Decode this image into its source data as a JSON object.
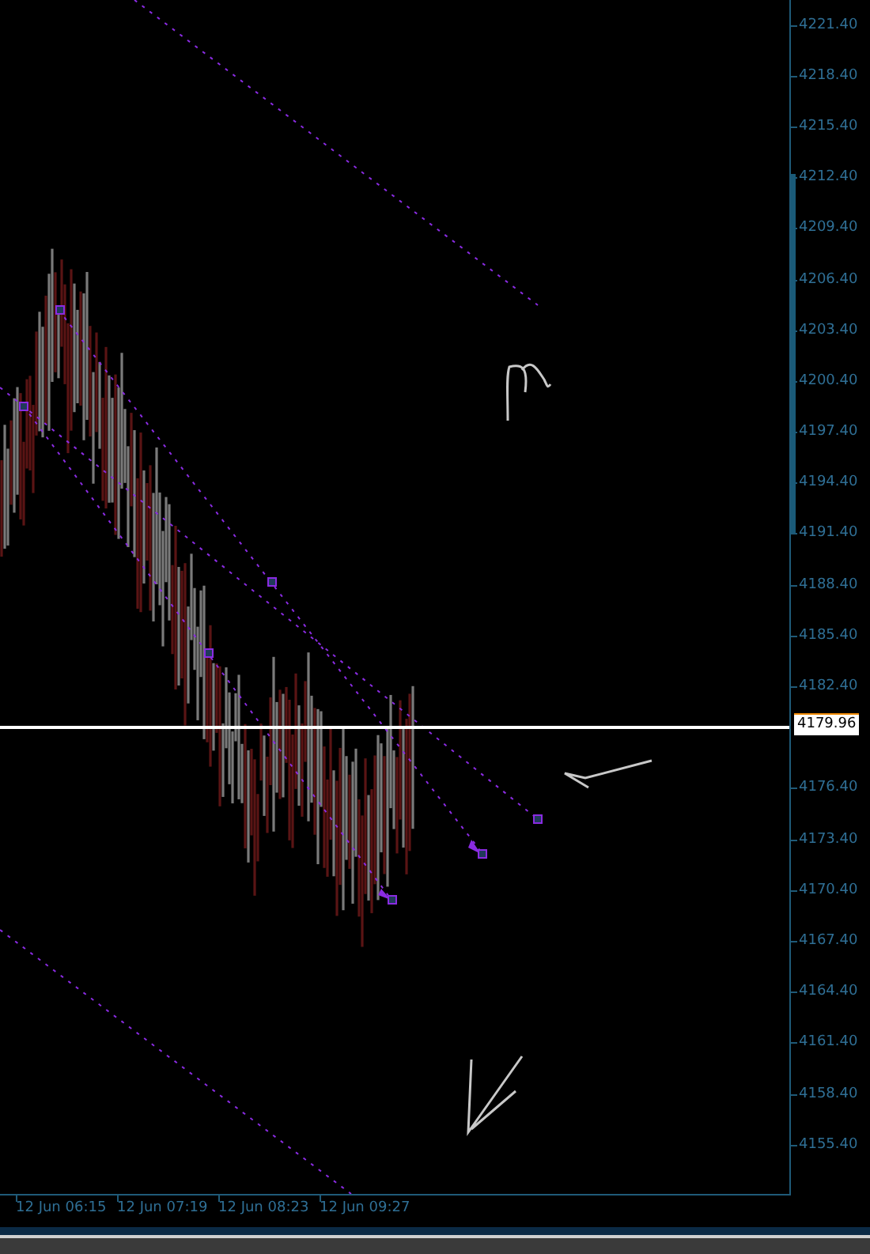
{
  "price_axis": {
    "labels_above": [
      "4221.40",
      "4218.40",
      "4215.40",
      "4212.40",
      "4209.40",
      "4206.40",
      "4203.40",
      "4200.40",
      "4197.40",
      "4194.40",
      "4191.40",
      "4188.40",
      "4185.40",
      "4182.40"
    ],
    "current_price": "4179.96",
    "labels_below": [
      "4176.40",
      "4173.40",
      "4170.40",
      "4167.40",
      "4164.40",
      "4161.40",
      "4158.40",
      "4155.40"
    ]
  },
  "time_axis": {
    "labels": [
      "12 Jun 06:15",
      "12 Jun 07:19",
      "12 Jun 08:23",
      "12 Jun 09:27"
    ]
  }
}
